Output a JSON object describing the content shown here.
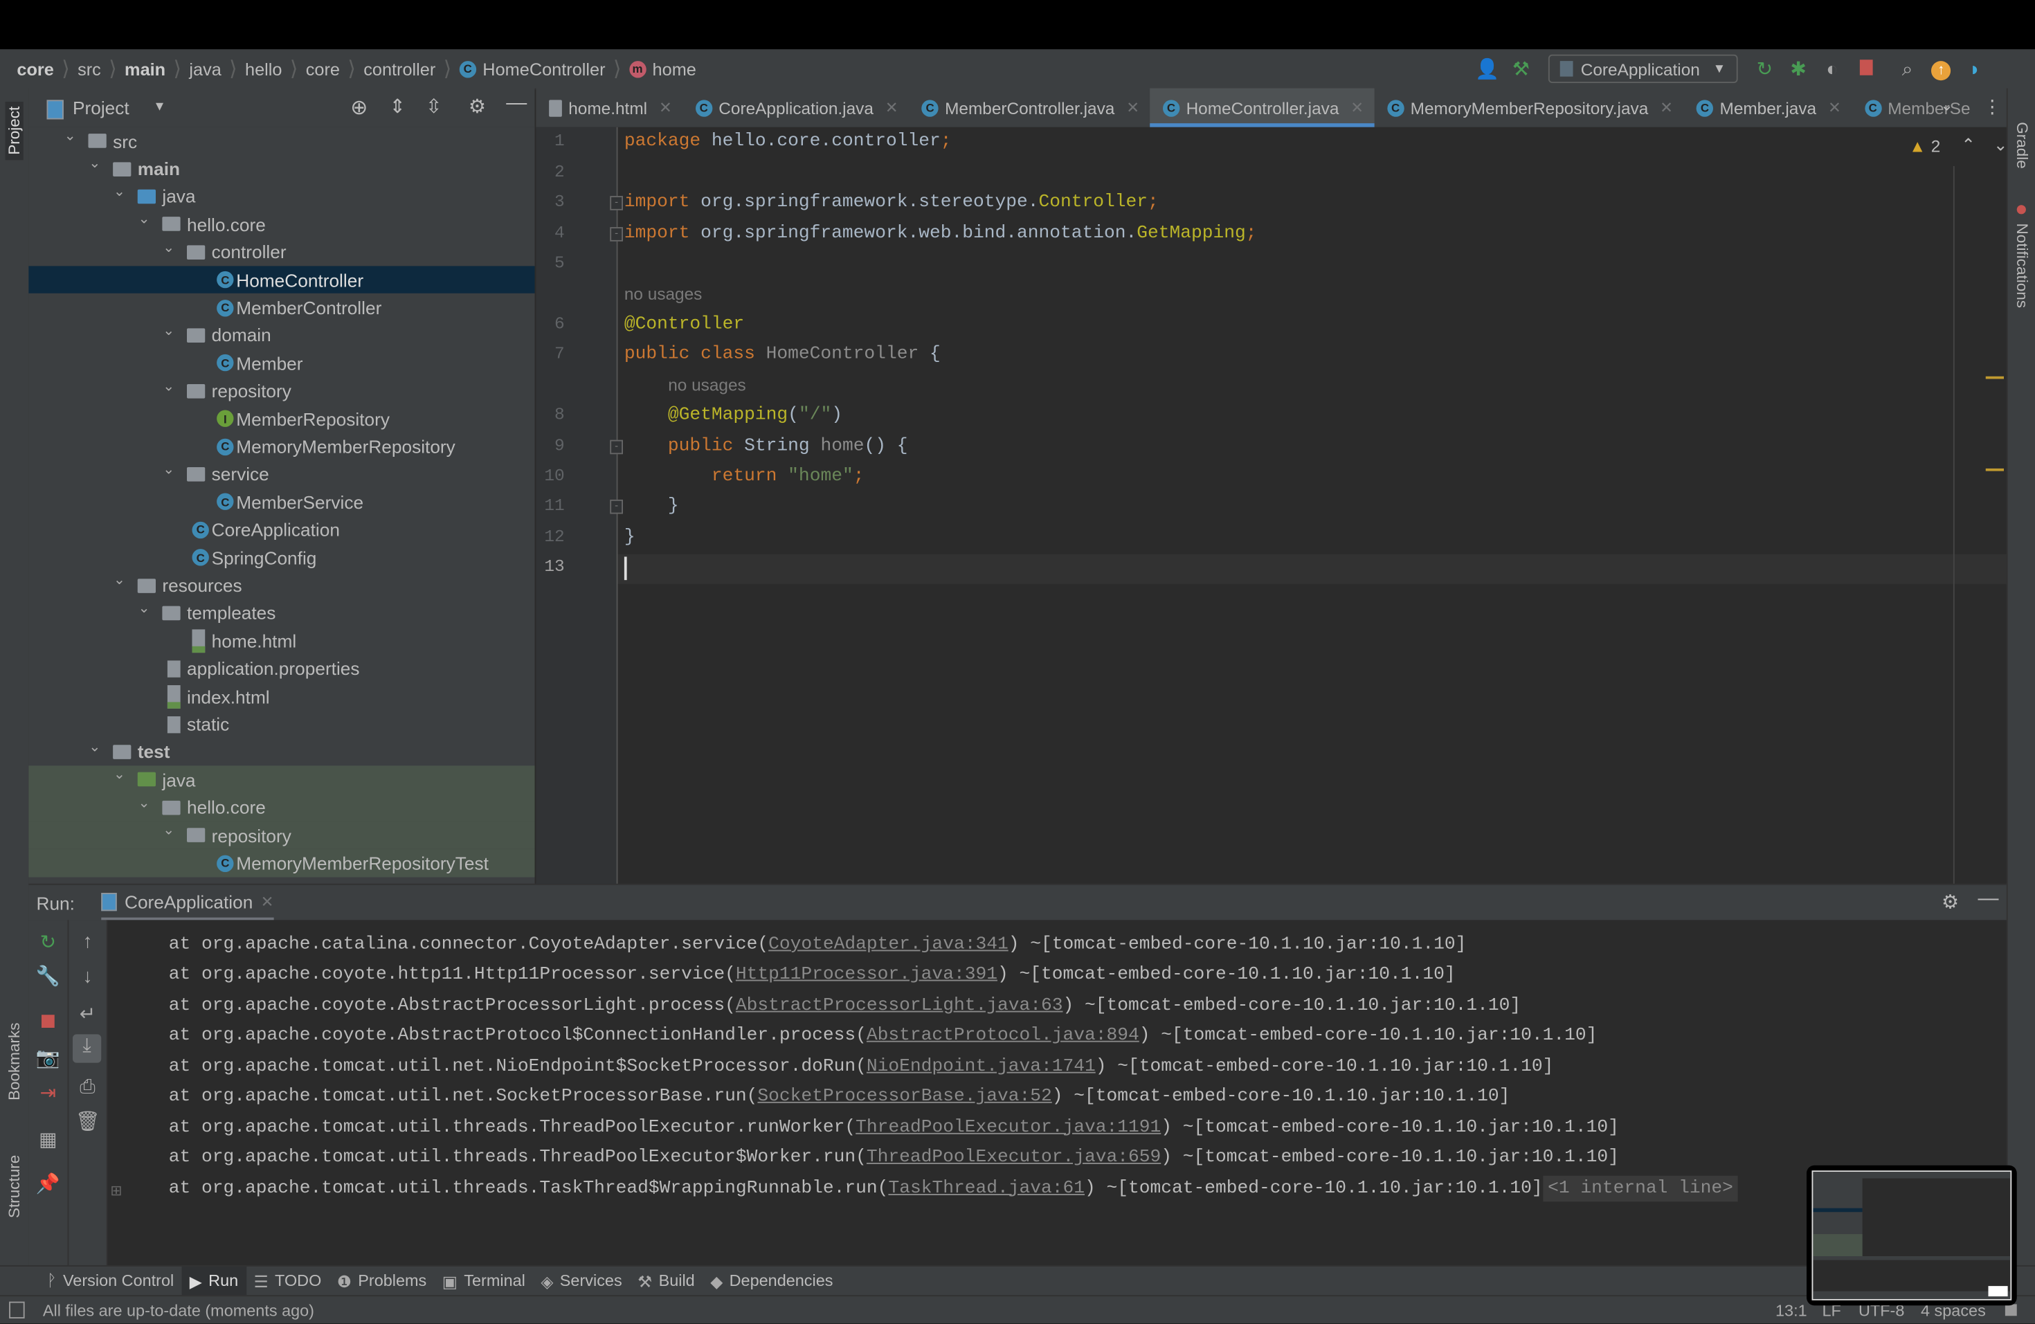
{
  "breadcrumb": [
    {
      "label": "core",
      "bold": true
    },
    {
      "label": "src"
    },
    {
      "label": "main",
      "bold": true
    },
    {
      "label": "java"
    },
    {
      "label": "hello"
    },
    {
      "label": "core"
    },
    {
      "label": "controller"
    },
    {
      "label": "HomeController",
      "icon": "class-icon"
    },
    {
      "label": "home",
      "icon": "method-icon"
    }
  ],
  "toolbar": {
    "run_config": "CoreApplication"
  },
  "project": {
    "title": "Project",
    "tree": [
      {
        "label": "src",
        "depth": 0,
        "type": "folder",
        "expanded": true
      },
      {
        "label": "main",
        "depth": 1,
        "type": "folder",
        "expanded": true,
        "bold": true
      },
      {
        "label": "java",
        "depth": 2,
        "type": "source-folder",
        "expanded": true
      },
      {
        "label": "hello.core",
        "depth": 3,
        "type": "package",
        "expanded": true
      },
      {
        "label": "controller",
        "depth": 4,
        "type": "package",
        "expanded": true
      },
      {
        "label": "HomeController",
        "depth": 5,
        "type": "class",
        "selected": true
      },
      {
        "label": "MemberController",
        "depth": 5,
        "type": "class"
      },
      {
        "label": "domain",
        "depth": 4,
        "type": "package",
        "expanded": true
      },
      {
        "label": "Member",
        "depth": 5,
        "type": "class"
      },
      {
        "label": "repository",
        "depth": 4,
        "type": "package",
        "expanded": true
      },
      {
        "label": "MemberRepository",
        "depth": 5,
        "type": "interface"
      },
      {
        "label": "MemoryMemberRepository",
        "depth": 5,
        "type": "class"
      },
      {
        "label": "service",
        "depth": 4,
        "type": "package",
        "expanded": true
      },
      {
        "label": "MemberService",
        "depth": 5,
        "type": "class"
      },
      {
        "label": "CoreApplication",
        "depth": 4,
        "type": "spring-class"
      },
      {
        "label": "SpringConfig",
        "depth": 4,
        "type": "class"
      },
      {
        "label": "resources",
        "depth": 2,
        "type": "resources-folder",
        "expanded": true
      },
      {
        "label": "templeates",
        "depth": 3,
        "type": "folder",
        "expanded": true
      },
      {
        "label": "home.html",
        "depth": 4,
        "type": "html"
      },
      {
        "label": "application.properties",
        "depth": 3,
        "type": "properties"
      },
      {
        "label": "index.html",
        "depth": 3,
        "type": "html"
      },
      {
        "label": "static",
        "depth": 3,
        "type": "file"
      },
      {
        "label": "test",
        "depth": 1,
        "type": "folder",
        "expanded": true,
        "bold": true
      },
      {
        "label": "java",
        "depth": 2,
        "type": "test-folder",
        "expanded": true,
        "highlight": true
      },
      {
        "label": "hello.core",
        "depth": 3,
        "type": "package",
        "expanded": true,
        "highlight": true
      },
      {
        "label": "repository",
        "depth": 4,
        "type": "package",
        "expanded": true,
        "highlight": true
      },
      {
        "label": "MemoryMemberRepositoryTest",
        "depth": 5,
        "type": "test-class",
        "highlight": true
      }
    ]
  },
  "tabs": [
    {
      "label": "home.html",
      "icon": "html-icon"
    },
    {
      "label": "CoreApplication.java",
      "icon": "class-icon"
    },
    {
      "label": "MemberController.java",
      "icon": "class-icon"
    },
    {
      "label": "HomeController.java",
      "icon": "class-icon",
      "active": true
    },
    {
      "label": "MemoryMemberRepository.java",
      "icon": "class-icon"
    },
    {
      "label": "Member.java",
      "icon": "class-icon"
    },
    {
      "label": "MemberSe",
      "icon": "class-icon",
      "truncated": true
    }
  ],
  "editor": {
    "warnings": "2",
    "current_line": 13,
    "lines": [
      {
        "num": "1",
        "tokens": [
          [
            "package ",
            "kw"
          ],
          [
            "hello.core.controller",
            "pl"
          ],
          [
            ";",
            "kw"
          ]
        ]
      },
      {
        "num": "2",
        "tokens": []
      },
      {
        "num": "3",
        "tokens": [
          [
            "import ",
            "kw"
          ],
          [
            "org.springframework.stereotype.",
            "pl"
          ],
          [
            "Controller",
            "an"
          ],
          [
            ";",
            "kw"
          ]
        ]
      },
      {
        "num": "4",
        "tokens": [
          [
            "import ",
            "kw"
          ],
          [
            "org.springframework.web.bind.annotation.",
            "pl"
          ],
          [
            "GetMapping",
            "an"
          ],
          [
            ";",
            "kw"
          ]
        ]
      },
      {
        "num": "5",
        "tokens": []
      },
      {
        "hint": "no usages",
        "indent": 0
      },
      {
        "num": "6",
        "tokens": [
          [
            "@Controller",
            "an"
          ]
        ]
      },
      {
        "num": "7",
        "tokens": [
          [
            "public class ",
            "kw"
          ],
          [
            "HomeController ",
            "mt"
          ],
          [
            "{",
            "pl"
          ]
        ]
      },
      {
        "hint": "no usages",
        "indent": 4
      },
      {
        "num": "8",
        "tokens": [
          [
            "    ",
            "pl"
          ],
          [
            "@GetMapping",
            "an"
          ],
          [
            "(",
            "pl"
          ],
          [
            "\"/\"",
            "st"
          ],
          [
            ")",
            "pl"
          ]
        ]
      },
      {
        "num": "9",
        "tokens": [
          [
            "    ",
            "pl"
          ],
          [
            "public ",
            "kw"
          ],
          [
            "String ",
            "pl"
          ],
          [
            "home",
            "mt"
          ],
          [
            "() {",
            "pl"
          ]
        ]
      },
      {
        "num": "10",
        "tokens": [
          [
            "        ",
            "pl"
          ],
          [
            "return ",
            "kw"
          ],
          [
            "\"home\"",
            "st"
          ],
          [
            ";",
            "kw"
          ]
        ]
      },
      {
        "num": "11",
        "tokens": [
          [
            "    }",
            "pl"
          ]
        ]
      },
      {
        "num": "12",
        "tokens": [
          [
            "}",
            "pl"
          ]
        ]
      },
      {
        "num": "13",
        "tokens": []
      }
    ]
  },
  "run": {
    "label": "Run:",
    "tab": "CoreApplication",
    "lines": [
      {
        "pre": "at org.apache.catalina.connector.CoyoteAdapter.service(",
        "link": "CoyoteAdapter.java:341",
        "post": ") ~[tomcat-embed-core-10.1.10.jar:10.1.10]"
      },
      {
        "pre": "at org.apache.coyote.http11.Http11Processor.service(",
        "link": "Http11Processor.java:391",
        "post": ") ~[tomcat-embed-core-10.1.10.jar:10.1.10]"
      },
      {
        "pre": "at org.apache.coyote.AbstractProcessorLight.process(",
        "link": "AbstractProcessorLight.java:63",
        "post": ") ~[tomcat-embed-core-10.1.10.jar:10.1.10]"
      },
      {
        "pre": "at org.apache.coyote.AbstractProtocol$ConnectionHandler.process(",
        "link": "AbstractProtocol.java:894",
        "post": ") ~[tomcat-embed-core-10.1.10.jar:10.1.10]"
      },
      {
        "pre": "at org.apache.tomcat.util.net.NioEndpoint$SocketProcessor.doRun(",
        "link": "NioEndpoint.java:1741",
        "post": ") ~[tomcat-embed-core-10.1.10.jar:10.1.10]"
      },
      {
        "pre": "at org.apache.tomcat.util.net.SocketProcessorBase.run(",
        "link": "SocketProcessorBase.java:52",
        "post": ") ~[tomcat-embed-core-10.1.10.jar:10.1.10]"
      },
      {
        "pre": "at org.apache.tomcat.util.threads.ThreadPoolExecutor.runWorker(",
        "link": "ThreadPoolExecutor.java:1191",
        "post": ") ~[tomcat-embed-core-10.1.10.jar:10.1.10]"
      },
      {
        "pre": "at org.apache.tomcat.util.threads.ThreadPoolExecutor$Worker.run(",
        "link": "ThreadPoolExecutor.java:659",
        "post": ") ~[tomcat-embed-core-10.1.10.jar:10.1.10]"
      },
      {
        "pre": "at org.apache.tomcat.util.threads.TaskThread$WrappingRunnable.run(",
        "link": "TaskThread.java:61",
        "post": ") ~[tomcat-embed-core-10.1.10.jar:10.1.10]",
        "extra": "<1 internal line>"
      }
    ]
  },
  "side_tabs": {
    "project": "Project",
    "bookmarks": "Bookmarks",
    "structure": "Structure",
    "gradle": "Gradle",
    "notifications": "Notifications"
  },
  "tool_windows": [
    {
      "label": "Version Control",
      "icon": "ᚹ"
    },
    {
      "label": "Run",
      "icon": "▶",
      "active": true
    },
    {
      "label": "TODO",
      "icon": "☰"
    },
    {
      "label": "Problems",
      "icon": "❶"
    },
    {
      "label": "Terminal",
      "icon": "▣"
    },
    {
      "label": "Services",
      "icon": "◈"
    },
    {
      "label": "Build",
      "icon": "⚒"
    },
    {
      "label": "Dependencies",
      "icon": "◆"
    }
  ],
  "status": {
    "message": "All files are up-to-date (moments ago)",
    "position": "13:1",
    "line_sep": "LF",
    "encoding": "UTF-8",
    "indent": "4 spaces"
  },
  "colors": {
    "accent": "#4a88c7",
    "selection": "#0d293e",
    "keyword": "#cc7832",
    "annotation": "#bbb529",
    "string": "#6a8759",
    "warning": "#d6a62a",
    "stop": "#c75450",
    "run_green": "#499c54"
  }
}
